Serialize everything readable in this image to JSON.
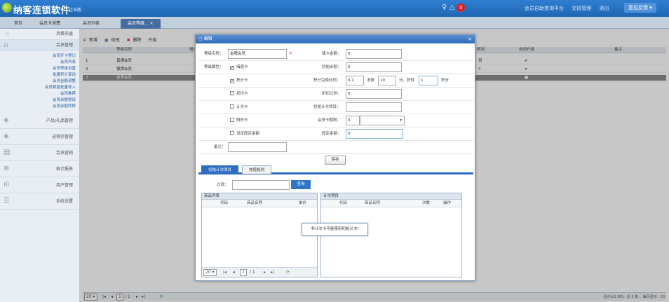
{
  "app": {
    "brand": "纳客连锁软件",
    "edition": "企业版",
    "notify_count": "0",
    "links": [
      "会员自助查询平台",
      "交班管理",
      "退出"
    ],
    "feedback": "意见反馈"
  },
  "nav": {
    "tabs": [
      "首页",
      "会员卡消费",
      "会员列表",
      "会员等级..."
    ]
  },
  "sidebar": {
    "header": "消费充值",
    "member_group": "会员管理",
    "member_items": [
      "会员开卡登记",
      "会员列表",
      "会员等级设置",
      "批量积分变动",
      "会员金额调整",
      "会员数据批量导入",
      "会员推荐",
      "会员余额提现",
      "会员余额转移"
    ],
    "groups": [
      "产品/礼品管理",
      "进销存管理",
      "会员营销",
      "统计报表",
      "用户管理",
      "系统设置"
    ]
  },
  "grid": {
    "toolbar": [
      "新增",
      "修改",
      "删除",
      "升级"
    ],
    "headers": [
      "等级名称",
      "储卡",
      "规则",
      "自动升级",
      "备注"
    ],
    "rows": [
      {
        "num": "1",
        "name": "普通会员",
        "rule": "员",
        "auto": "✔"
      },
      {
        "num": "2",
        "name": "银牌会员",
        "rule": "3",
        "auto": "✔"
      },
      {
        "num": "3",
        "name": "金牌会员",
        "rule": "3",
        "auto": "■"
      }
    ],
    "page_size": "20",
    "page_current": "1",
    "page_total": "/ 1",
    "status": "显示从1 到3，总 3 条 。每页显示：20"
  },
  "dialog": {
    "title": "编辑",
    "fields": {
      "level_name_label": "等级名称：",
      "level_name": "金牌会员",
      "store_amount_label": "储卡金额：",
      "store_amount": "0",
      "attr_label": "等级属性：",
      "init_balance_label": "初始余额：",
      "init_balance": "0",
      "points_ratio_label": "积分兑换比例：",
      "points_ratio": "0.1",
      "consume_label": "消费",
      "consume_value": "10",
      "yuan_label": "元，获得",
      "points_value": "1",
      "points_unit": "积分",
      "discount_label": "折扣比例：",
      "discount_value": "0",
      "init_count_label": "初始计次项目：",
      "card_period_label": "会员卡期限：",
      "card_period_value": "0",
      "fixed_amount_label": "固定金额：",
      "fixed_amount": "0",
      "remark_label": "备注：",
      "save_label": "保存"
    },
    "checkboxes": [
      {
        "label": "储值卡",
        "checked": true
      },
      {
        "label": "积分卡",
        "checked": true
      },
      {
        "label": "折扣卡",
        "checked": false
      },
      {
        "label": "计次卡",
        "checked": false
      },
      {
        "label": "限时卡",
        "checked": false
      },
      {
        "label": "设定固定金额",
        "checked": false
      }
    ],
    "tabs": [
      "初始计次项目",
      "充值规则"
    ],
    "filter_label": "过滤：",
    "query_label": "查询",
    "left_panel": {
      "title": "商品列表",
      "headers": [
        "代码",
        "商品名称",
        "单价"
      ],
      "page_size": "20",
      "page_current": "1",
      "page_total": "/ 1"
    },
    "right_panel": {
      "title": "计次项目",
      "headers": [
        "代码",
        "商品名称",
        "次数",
        "操作"
      ]
    },
    "tip": "非计次卡不能使用初始计次!"
  }
}
